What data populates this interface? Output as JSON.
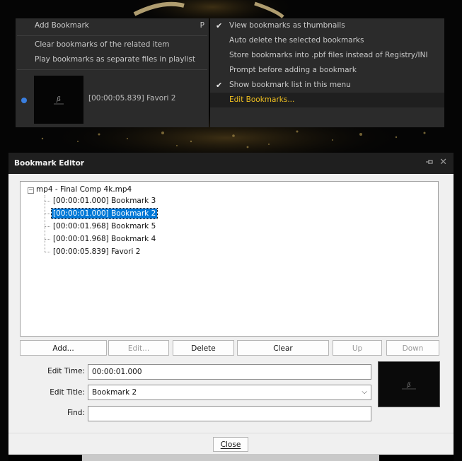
{
  "context_menu": {
    "left_items": [
      {
        "label": "Add Bookmark",
        "shortcut": "P"
      },
      {
        "label": "Clear bookmarks of the related item"
      },
      {
        "label": "Play bookmarks as separate files in playlist"
      }
    ],
    "current_bookmark": "[00:00:05.839] Favori 2",
    "right_items": [
      {
        "label": "View bookmarks as thumbnails",
        "checked": true
      },
      {
        "label": "Auto delete the selected bookmarks",
        "checked": false
      },
      {
        "label": "Store bookmarks into .pbf files instead of Registry/INI",
        "checked": false
      },
      {
        "label": "Prompt before adding a bookmark",
        "checked": false
      },
      {
        "label": "Show bookmark list in this menu",
        "checked": true
      },
      {
        "label": "Edit Bookmarks...",
        "active": true
      }
    ],
    "check_glyph": "✔"
  },
  "editor": {
    "title": "Bookmark Editor",
    "pin_icon": "pin-icon",
    "close_glyph": "✕",
    "tree": {
      "root_toggle": "−",
      "root": "mp4 - Final Comp 4k.mp4",
      "items": [
        "[00:00:01.000] Bookmark 3",
        "[00:00:01.000] Bookmark 2",
        "[00:00:01.968] Bookmark 5",
        "[00:00:01.968] Bookmark 4",
        "[00:00:05.839] Favori 2"
      ],
      "selected_index": 1
    },
    "buttons": {
      "add": "Add...",
      "edit": "Edit...",
      "delete": "Delete",
      "clear": "Clear",
      "up": "Up",
      "down": "Down"
    },
    "fields": {
      "time_label": "Edit Time:",
      "time_value": "00:00:01.000",
      "title_label": "Edit Title:",
      "title_value": "Bookmark 2",
      "find_label": "Find:",
      "find_value": ""
    },
    "close_button": "Close"
  },
  "colors": {
    "menu_bg": "#2b2b2b",
    "menu_highlight_text": "#f0c020",
    "selection": "#0078d7",
    "dialog_bg": "#f0f0f0"
  }
}
